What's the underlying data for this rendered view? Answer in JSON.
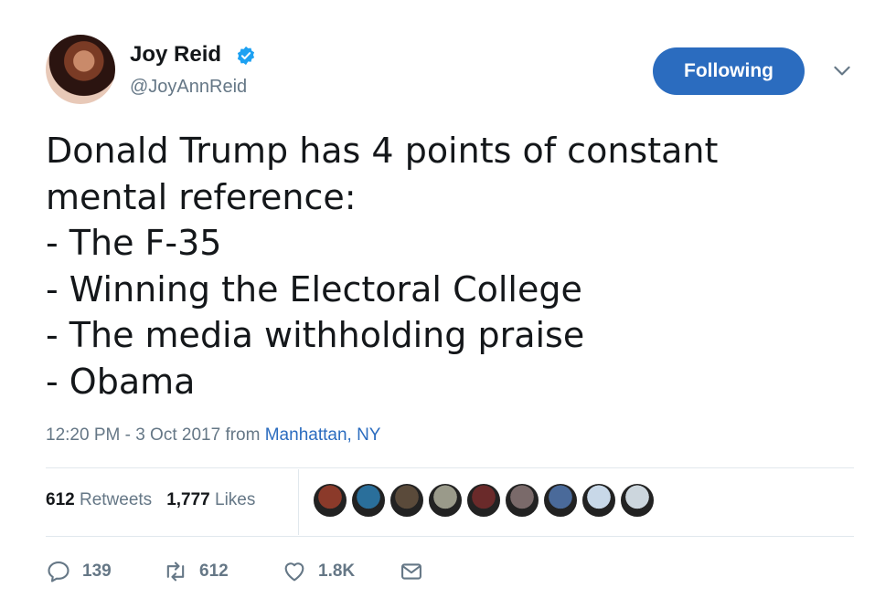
{
  "author": {
    "name": "Joy Reid",
    "handle": "@JoyAnnReid",
    "verified": true
  },
  "follow_button": {
    "label": "Following"
  },
  "tweet": {
    "lines": [
      "Donald Trump has 4 points of constant",
      "mental reference:",
      "- The F-35",
      "- Winning the Electoral College",
      "- The media withholding praise",
      "- Obama"
    ]
  },
  "meta": {
    "timestamp": "12:20 PM - 3 Oct 2017",
    "from_label": "from",
    "location": "Manhattan, NY"
  },
  "stats": {
    "retweets_count": "612",
    "retweets_label": "Retweets",
    "likes_count": "1,777",
    "likes_label": "Likes"
  },
  "likers": [
    {
      "color": "#8b3a2a"
    },
    {
      "color": "#2a6f9b"
    },
    {
      "color": "#5a4a3a"
    },
    {
      "color": "#9a9a8a"
    },
    {
      "color": "#6a2a2a"
    },
    {
      "color": "#7a6a6a"
    },
    {
      "color": "#4a6a9a"
    },
    {
      "color": "#c8d8e8"
    },
    {
      "color": "#ccd6dd"
    }
  ],
  "actions": {
    "replies": "139",
    "retweets": "612",
    "likes": "1.8K"
  },
  "colors": {
    "accent": "#2b6cbf",
    "secondary_text": "#657786"
  }
}
